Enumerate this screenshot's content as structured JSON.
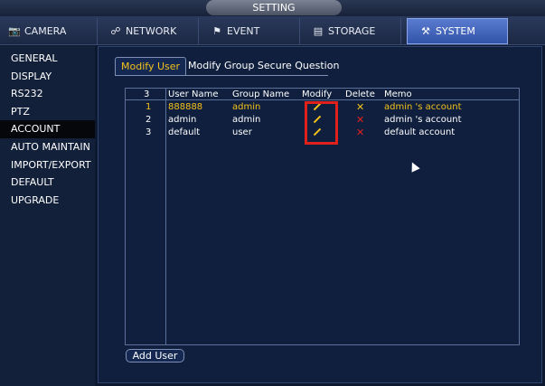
{
  "title": "SETTING",
  "tabs": [
    {
      "label": "CAMERA",
      "icon": "camera-icon"
    },
    {
      "label": "NETWORK",
      "icon": "network-icon"
    },
    {
      "label": "EVENT",
      "icon": "event-icon"
    },
    {
      "label": "STORAGE",
      "icon": "storage-icon"
    },
    {
      "label": "SYSTEM",
      "icon": "system-icon",
      "active": true
    }
  ],
  "sidebar": {
    "items": [
      {
        "label": "GENERAL"
      },
      {
        "label": "DISPLAY"
      },
      {
        "label": "RS232"
      },
      {
        "label": "PTZ"
      },
      {
        "label": "ACCOUNT",
        "active": true
      },
      {
        "label": "AUTO MAINTAIN"
      },
      {
        "label": "IMPORT/EXPORT"
      },
      {
        "label": "DEFAULT"
      },
      {
        "label": "UPGRADE"
      }
    ]
  },
  "subtabs": {
    "modify_user": "Modify User",
    "modify_group": "Modify Group Secure Question"
  },
  "table": {
    "count": "3",
    "headers": {
      "user_name": "User Name",
      "group_name": "Group Name",
      "modify": "Modify",
      "delete": "Delete",
      "memo": "Memo"
    },
    "rows": [
      {
        "index": "1",
        "user": "888888",
        "group": "admin",
        "memo": "admin 's account",
        "selected": true
      },
      {
        "index": "2",
        "user": "admin",
        "group": "admin",
        "memo": "admin 's account"
      },
      {
        "index": "3",
        "user": "default",
        "group": "user",
        "memo": "default account"
      }
    ]
  },
  "add_user_label": "Add User",
  "colors": {
    "accent": "#f3c21a",
    "delete": "#e52020",
    "highlight": "#e0201a",
    "active_tab": "#4366c0"
  }
}
